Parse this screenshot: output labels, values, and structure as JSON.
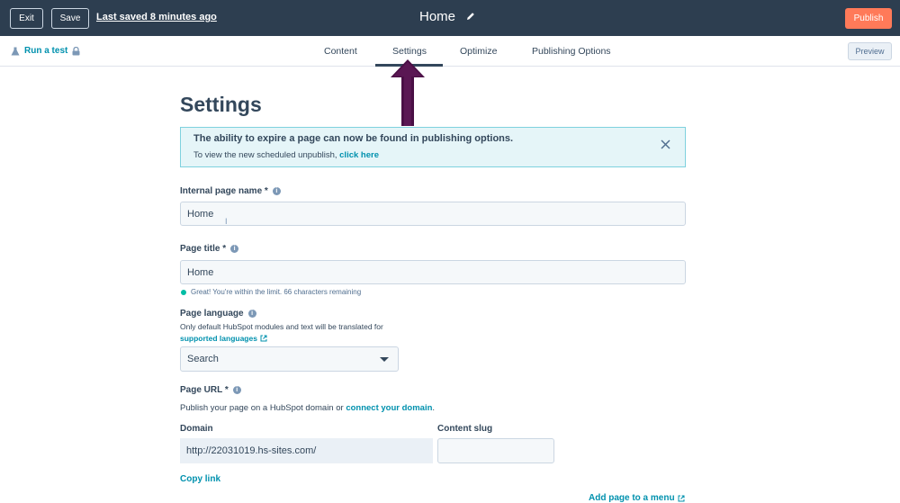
{
  "topbar": {
    "exit_label": "Exit",
    "save_label": "Save",
    "last_saved": "Last saved 8 minutes ago",
    "page_name": "Home",
    "publish_label": "Publish"
  },
  "subbar": {
    "run_test_label": "Run a test",
    "tabs": [
      {
        "label": "Content"
      },
      {
        "label": "Settings",
        "active": true
      },
      {
        "label": "Optimize"
      },
      {
        "label": "Publishing Options"
      }
    ],
    "preview_label": "Preview"
  },
  "main": {
    "title": "Settings",
    "banner": {
      "title": "The ability to expire a page can now be found in publishing options.",
      "body": "To view the new scheduled unpublish, ",
      "link": "click here"
    },
    "internal_name": {
      "label": "Internal page name *",
      "value": "Home"
    },
    "page_title": {
      "label": "Page title *",
      "value": "Home",
      "hint": "Great! You're within the limit. 66 characters remaining"
    },
    "page_language": {
      "label": "Page language",
      "help": "Only default HubSpot modules and text will be translated for",
      "help_link": "supported languages",
      "select_value": "Search"
    },
    "page_url": {
      "label": "Page URL *",
      "help": "Publish your page on a HubSpot domain or ",
      "help_link": "connect your domain",
      "help_end": ".",
      "domain_label": "Domain",
      "domain_value": "http://22031019.hs-sites.com/",
      "slug_label": "Content slug",
      "slug_value": ""
    },
    "copy_link": "Copy link",
    "add_to_menu": "Add page to a menu"
  },
  "colors": {
    "topbar_bg": "#2d3e50",
    "publish": "#ff7a59",
    "link": "#0091ae",
    "arrow": "#4a0f45",
    "banner_bg": "#e5f5f8"
  }
}
